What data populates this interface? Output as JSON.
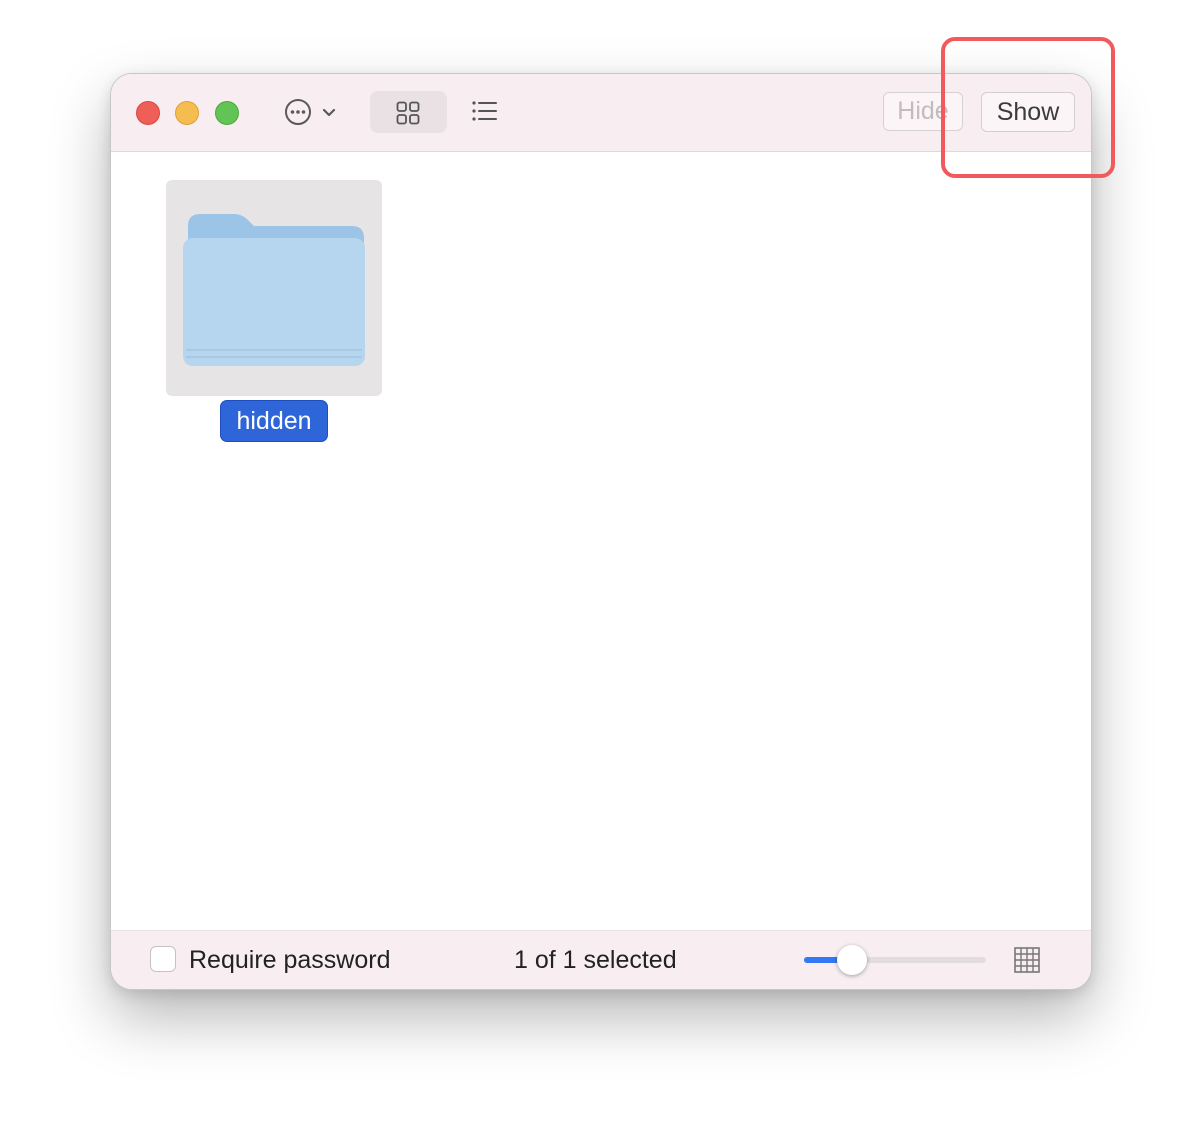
{
  "toolbar": {
    "traffic_lights": [
      "close",
      "minimize",
      "zoom"
    ],
    "more_icon": "ellipsis-circle-icon",
    "grid_view_icon": "grid-view-icon",
    "list_view_icon": "list-view-icon",
    "hide_label": "Hide",
    "show_label": "Show"
  },
  "content": {
    "items": [
      {
        "name": "hidden",
        "icon": "folder-icon",
        "selected": true
      }
    ]
  },
  "statusbar": {
    "require_password_label": "Require password",
    "require_password_checked": false,
    "selection_status": "1 of 1 selected",
    "icon_size_fraction": 0.22,
    "grid_size_icon": "grid-size-icon"
  },
  "colors": {
    "accent": "#3478f6",
    "selection": "#2e65d8",
    "highlight": "#f2595b",
    "toolbar_bg": "#f8eef1"
  }
}
